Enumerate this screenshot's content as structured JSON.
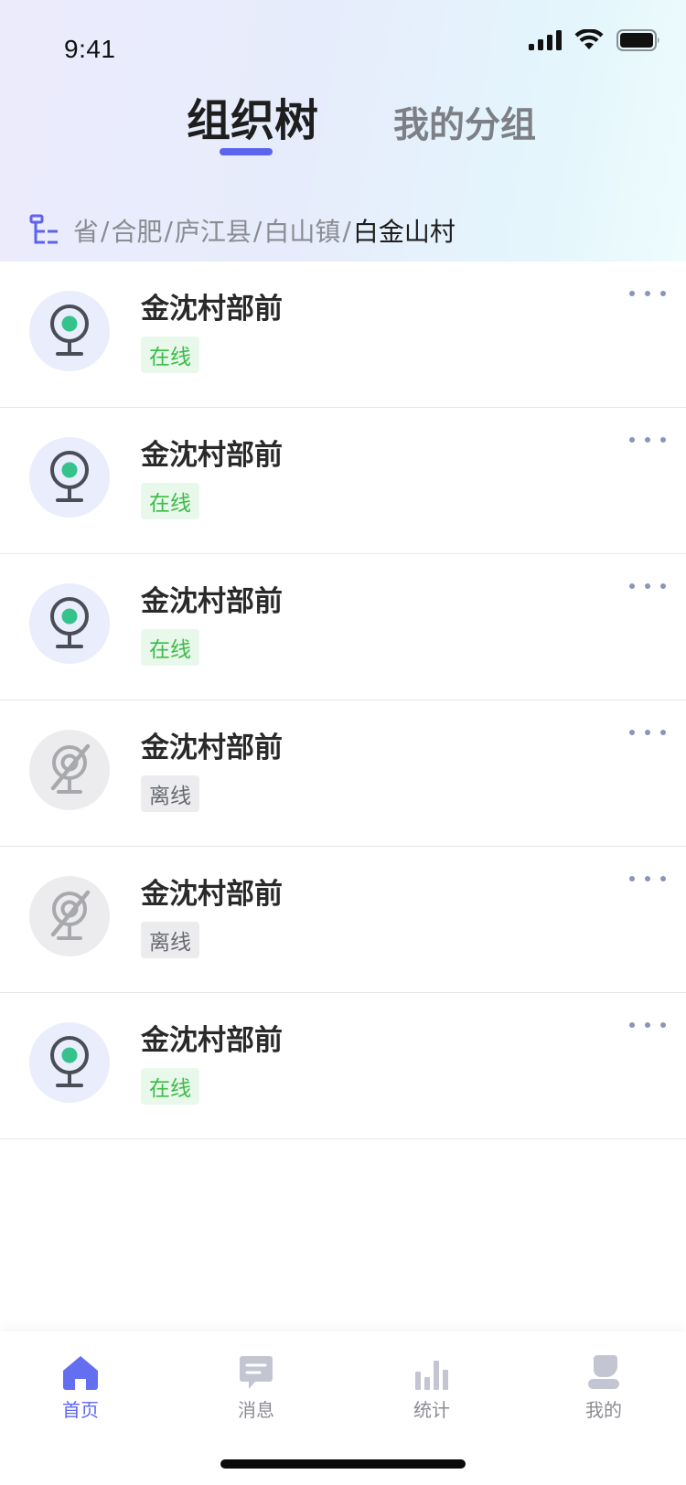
{
  "status_bar": {
    "time": "9:41"
  },
  "tabs": [
    {
      "label": "组织树",
      "active": true
    },
    {
      "label": "我的分组",
      "active": false
    }
  ],
  "breadcrumb": {
    "separator": "/",
    "items": [
      "省",
      "合肥",
      "庐江县",
      "白山镇",
      "白金山村"
    ]
  },
  "devices": [
    {
      "name": "金沈村部前",
      "status": "在线",
      "online": true
    },
    {
      "name": "金沈村部前",
      "status": "在线",
      "online": true
    },
    {
      "name": "金沈村部前",
      "status": "在线",
      "online": true
    },
    {
      "name": "金沈村部前",
      "status": "离线",
      "online": false
    },
    {
      "name": "金沈村部前",
      "status": "离线",
      "online": false
    },
    {
      "name": "金沈村部前",
      "status": "在线",
      "online": true
    }
  ],
  "tabbar": [
    {
      "label": "首页",
      "icon": "home-icon",
      "active": true
    },
    {
      "label": "消息",
      "icon": "message-icon",
      "active": false
    },
    {
      "label": "统计",
      "icon": "chart-icon",
      "active": false
    },
    {
      "label": "我的",
      "icon": "user-icon",
      "active": false
    }
  ],
  "colors": {
    "accent": "#5c63ec",
    "online_text": "#3dbb49",
    "online_bg": "#e8f8ea",
    "offline_text": "#666a70",
    "offline_bg": "#ececee",
    "camera_green": "#36c28b"
  }
}
